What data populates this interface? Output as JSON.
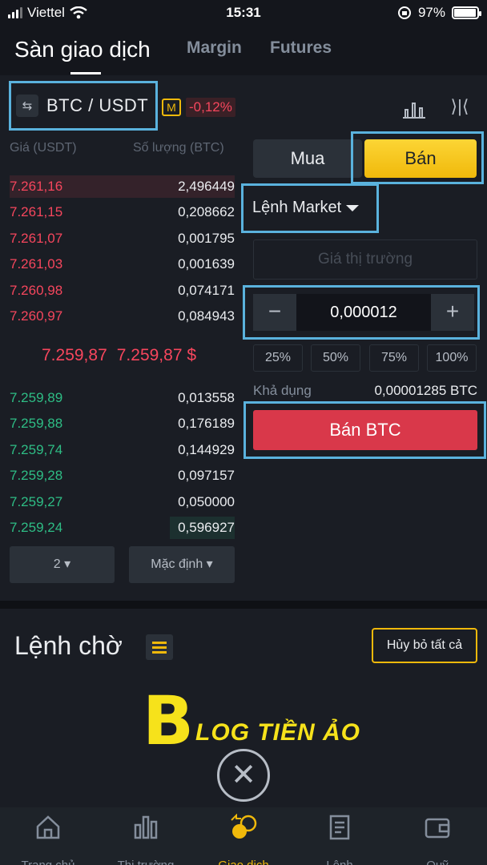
{
  "status": {
    "carrier": "Viettel",
    "time": "15:31",
    "battery": "97%",
    "battery_level": 0.97
  },
  "tabs": [
    {
      "label": "Sàn giao dịch"
    },
    {
      "label": "Margin"
    },
    {
      "label": "Futures"
    }
  ],
  "pair": {
    "name": "BTC / USDT",
    "margin_tag": "M",
    "change": "-0,12%"
  },
  "orderbook": {
    "price_header": "Giá (USDT)",
    "qty_header": "Số lượng (BTC)",
    "asks": [
      {
        "price": "7.261,16",
        "qty": "2,496449",
        "depth": 1.0
      },
      {
        "price": "7.261,15",
        "qty": "0,208662",
        "depth": 0.0
      },
      {
        "price": "7.261,07",
        "qty": "0,001795",
        "depth": 0.0
      },
      {
        "price": "7.261,03",
        "qty": "0,001639",
        "depth": 0.0
      },
      {
        "price": "7.260,98",
        "qty": "0,074171",
        "depth": 0.0
      },
      {
        "price": "7.260,97",
        "qty": "0,084943",
        "depth": 0.0
      }
    ],
    "last_price": "7.259,87",
    "last_price_usd": "7.259,87 $",
    "bids": [
      {
        "price": "7.259,89",
        "qty": "0,013558",
        "depth": 0.0
      },
      {
        "price": "7.259,88",
        "qty": "0,176189",
        "depth": 0.0
      },
      {
        "price": "7.259,74",
        "qty": "0,144929",
        "depth": 0.0
      },
      {
        "price": "7.259,28",
        "qty": "0,097157",
        "depth": 0.0
      },
      {
        "price": "7.259,27",
        "qty": "0,050000",
        "depth": 0.0
      },
      {
        "price": "7.259,24",
        "qty": "0,596927",
        "depth": 0.29
      }
    ],
    "decimals_select": "2",
    "view_select": "Mặc định"
  },
  "form": {
    "buy_label": "Mua",
    "sell_label": "Bán",
    "order_type": "Lệnh Market",
    "market_price_placeholder": "Giá thị trường",
    "amount": "0,000012",
    "minus": "−",
    "plus": "+",
    "percents": [
      "25%",
      "50%",
      "75%",
      "100%"
    ],
    "available_label": "Khả dụng",
    "available_value": "0,00001285 BTC",
    "submit_label": "Bán BTC"
  },
  "open_orders": {
    "title": "Lệnh chờ",
    "cancel_all": "Hủy bỏ tất cả",
    "watermark_b": "B",
    "watermark_text": "LOG TIỀN ẢO",
    "empty_icon": "close-circle-icon"
  },
  "bottom_nav": [
    {
      "label": "Trang chủ",
      "icon": "home-icon"
    },
    {
      "label": "Thị trường",
      "icon": "market-icon"
    },
    {
      "label": "Giao dịch",
      "icon": "trade-icon"
    },
    {
      "label": "Lệnh",
      "icon": "orders-icon"
    },
    {
      "label": "Quỹ",
      "icon": "wallet-icon"
    }
  ],
  "colors": {
    "accent": "#f0b90b",
    "sell": "#f6465d",
    "buy": "#2ebd85",
    "highlight": "#5ab2dd"
  }
}
